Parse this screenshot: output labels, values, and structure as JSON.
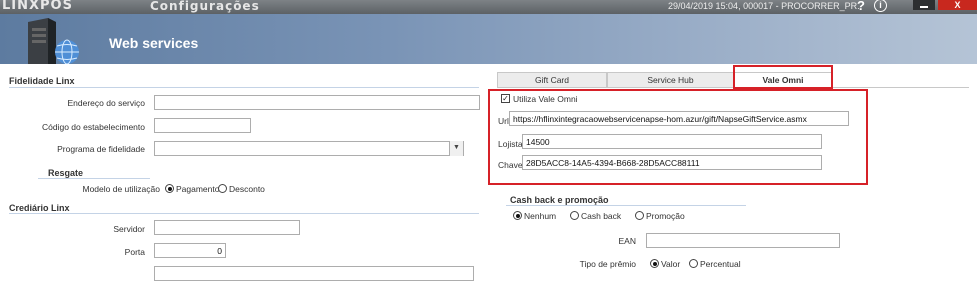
{
  "topbar": {
    "logo": "LINXPOS",
    "title": "Configurações",
    "session": "29/04/2019 15:04, 000017 - PROCORRER_PR.",
    "help_glyph": "?",
    "info_glyph": "i",
    "close_glyph": "X"
  },
  "header": {
    "title": "Web services",
    "icon": "server-globe-icon"
  },
  "fidelidade": {
    "title": "Fidelidade Linx",
    "endereco_label": "Endereço do serviço",
    "endereco_value": "",
    "codigo_label": "Código do estabelecimento",
    "codigo_value": "",
    "programa_label": "Programa de fidelidade",
    "programa_value": ""
  },
  "resgate": {
    "title": "Resgate",
    "modelo_label": "Modelo de utilização",
    "option_pagamento": "Pagamento",
    "option_desconto": "Desconto",
    "selected": "Pagamento"
  },
  "crediario": {
    "title": "Crediário Linx",
    "servidor_label": "Servidor",
    "servidor_value": "",
    "porta_label": "Porta",
    "porta_value": "0"
  },
  "tabs": [
    {
      "label": "Gift Card"
    },
    {
      "label": "Service Hub"
    },
    {
      "label": "Vale Omni"
    }
  ],
  "active_tab": "Vale Omni",
  "vale_omni": {
    "utiliza_label": "Utiliza Vale Omni",
    "utiliza_checked": true,
    "check_glyph": "✓",
    "url_label": "Url",
    "url_value": "https://hflinxintegracaowebservicenapse-hom.azur/gift/NapseGiftService.asmx",
    "lojista_label": "Lojista",
    "lojista_value": "14500",
    "chave_label": "Chave",
    "chave_value": "28D5ACC8-14A5-4394-B668-28D5ACC88111"
  },
  "cashback": {
    "title": "Cash back e promoção",
    "option_nenhum": "Nenhum",
    "option_cashback": "Cash back",
    "option_promocao": "Promoção",
    "selected": "Nenhum",
    "ean_label": "EAN",
    "ean_value": "",
    "tipo_label": "Tipo de prêmio",
    "option_valor": "Valor",
    "option_percentual": "Percentual",
    "tipo_selected": "Valor"
  },
  "colors": {
    "highlight": "#d62128",
    "header_start": "#5d7ba0",
    "header_end": "#b5c4d6"
  }
}
